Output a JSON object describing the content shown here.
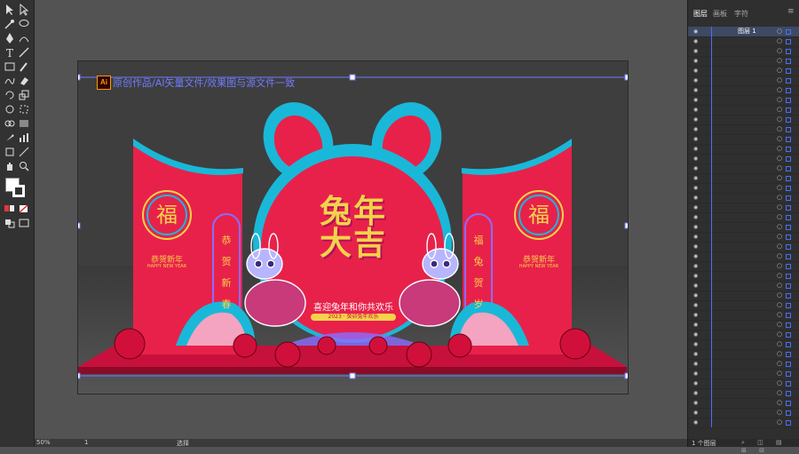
{
  "artboard": {
    "header_text": "原创作品/AI矢量文件/效果图与源文件一致",
    "ai_badge": "Ai"
  },
  "design": {
    "main_title_line1": "兔年",
    "main_title_line2": "大吉",
    "slogan": "喜迎兔年和你共欢乐",
    "ribbon_text": "2023 · 癸卯兔年欢乐",
    "left_panel": {
      "fu": "福",
      "greeting": "恭贺新年",
      "english": "HAPPY NEW YEAR",
      "vertical": [
        "恭",
        "贺",
        "新",
        "春"
      ]
    },
    "right_panel": {
      "fu": "福",
      "greeting": "恭贺新年",
      "english": "HAPPY NEW YEAR",
      "vertical": [
        "福",
        "兔",
        "贺",
        "岁"
      ]
    }
  },
  "panel": {
    "tabs": [
      "图层",
      "画板",
      "字符"
    ],
    "top_layer_name": "图层 1",
    "footer": "1 个图层"
  },
  "status": {
    "zoom": "50%",
    "page": "1",
    "tool_name": "选择"
  },
  "colors": {
    "accent_blue": "#6f7cff",
    "red": "#e8214a",
    "cyan": "#19b8d8",
    "gold": "#f4d24b"
  }
}
